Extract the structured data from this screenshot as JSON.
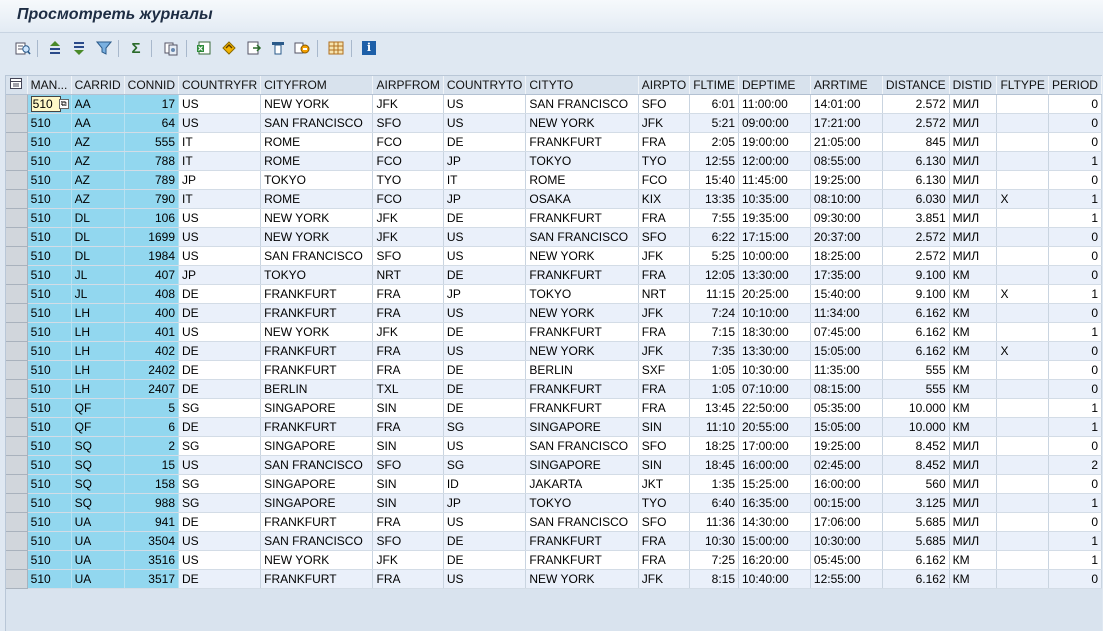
{
  "window": {
    "title": "Просмотреть журналы"
  },
  "toolbar": {
    "buttons": [
      {
        "icon": "details-icon",
        "label": ""
      },
      {
        "icon": "sort-ascending-icon",
        "label": ""
      },
      {
        "icon": "sort-descending-icon",
        "label": ""
      },
      {
        "icon": "filter-icon",
        "label": ""
      },
      {
        "icon": "sum-icon",
        "label": ""
      },
      {
        "icon": "subtotals-icon",
        "label": ""
      },
      {
        "icon": "export-excel-icon",
        "label": ""
      },
      {
        "icon": "print-preview-icon",
        "label": ""
      },
      {
        "icon": "export-icon",
        "label": ""
      },
      {
        "icon": "change-layout-icon",
        "label": ""
      },
      {
        "icon": "select-layout-icon",
        "label": ""
      },
      {
        "icon": "grid-layout-icon",
        "label": ""
      },
      {
        "icon": "info-icon",
        "label": "i"
      }
    ]
  },
  "grid": {
    "columns": [
      "MAN...",
      "CARRID",
      "CONNID",
      "COUNTRYFR",
      "CITYFROM",
      "AIRPFROM",
      "COUNTRYTO",
      "CITYTO",
      "AIRPTO",
      "FLTIME",
      "DEPTIME",
      "ARRTIME",
      "DISTANCE",
      "DISTID",
      "FLTYPE",
      "PERIOD"
    ],
    "rows": [
      [
        "510",
        "AA",
        "17",
        "US",
        "NEW YORK",
        "JFK",
        "US",
        "SAN FRANCISCO",
        "SFO",
        "6:01",
        "11:00:00",
        "14:01:00",
        "2.572",
        "МИЛ",
        "",
        "0"
      ],
      [
        "510",
        "AA",
        "64",
        "US",
        "SAN FRANCISCO",
        "SFO",
        "US",
        "NEW YORK",
        "JFK",
        "5:21",
        "09:00:00",
        "17:21:00",
        "2.572",
        "МИЛ",
        "",
        "0"
      ],
      [
        "510",
        "AZ",
        "555",
        "IT",
        "ROME",
        "FCO",
        "DE",
        "FRANKFURT",
        "FRA",
        "2:05",
        "19:00:00",
        "21:05:00",
        "845",
        "МИЛ",
        "",
        "0"
      ],
      [
        "510",
        "AZ",
        "788",
        "IT",
        "ROME",
        "FCO",
        "JP",
        "TOKYO",
        "TYO",
        "12:55",
        "12:00:00",
        "08:55:00",
        "6.130",
        "МИЛ",
        "",
        "1"
      ],
      [
        "510",
        "AZ",
        "789",
        "JP",
        "TOKYO",
        "TYO",
        "IT",
        "ROME",
        "FCO",
        "15:40",
        "11:45:00",
        "19:25:00",
        "6.130",
        "МИЛ",
        "",
        "0"
      ],
      [
        "510",
        "AZ",
        "790",
        "IT",
        "ROME",
        "FCO",
        "JP",
        "OSAKA",
        "KIX",
        "13:35",
        "10:35:00",
        "08:10:00",
        "6.030",
        "МИЛ",
        "X",
        "1"
      ],
      [
        "510",
        "DL",
        "106",
        "US",
        "NEW YORK",
        "JFK",
        "DE",
        "FRANKFURT",
        "FRA",
        "7:55",
        "19:35:00",
        "09:30:00",
        "3.851",
        "МИЛ",
        "",
        "1"
      ],
      [
        "510",
        "DL",
        "1699",
        "US",
        "NEW YORK",
        "JFK",
        "US",
        "SAN FRANCISCO",
        "SFO",
        "6:22",
        "17:15:00",
        "20:37:00",
        "2.572",
        "МИЛ",
        "",
        "0"
      ],
      [
        "510",
        "DL",
        "1984",
        "US",
        "SAN FRANCISCO",
        "SFO",
        "US",
        "NEW YORK",
        "JFK",
        "5:25",
        "10:00:00",
        "18:25:00",
        "2.572",
        "МИЛ",
        "",
        "0"
      ],
      [
        "510",
        "JL",
        "407",
        "JP",
        "TOKYO",
        "NRT",
        "DE",
        "FRANKFURT",
        "FRA",
        "12:05",
        "13:30:00",
        "17:35:00",
        "9.100",
        "КМ",
        "",
        "0"
      ],
      [
        "510",
        "JL",
        "408",
        "DE",
        "FRANKFURT",
        "FRA",
        "JP",
        "TOKYO",
        "NRT",
        "11:15",
        "20:25:00",
        "15:40:00",
        "9.100",
        "КМ",
        "X",
        "1"
      ],
      [
        "510",
        "LH",
        "400",
        "DE",
        "FRANKFURT",
        "FRA",
        "US",
        "NEW YORK",
        "JFK",
        "7:24",
        "10:10:00",
        "11:34:00",
        "6.162",
        "КМ",
        "",
        "0"
      ],
      [
        "510",
        "LH",
        "401",
        "US",
        "NEW YORK",
        "JFK",
        "DE",
        "FRANKFURT",
        "FRA",
        "7:15",
        "18:30:00",
        "07:45:00",
        "6.162",
        "КМ",
        "",
        "1"
      ],
      [
        "510",
        "LH",
        "402",
        "DE",
        "FRANKFURT",
        "FRA",
        "US",
        "NEW YORK",
        "JFK",
        "7:35",
        "13:30:00",
        "15:05:00",
        "6.162",
        "КМ",
        "X",
        "0"
      ],
      [
        "510",
        "LH",
        "2402",
        "DE",
        "FRANKFURT",
        "FRA",
        "DE",
        "BERLIN",
        "SXF",
        "1:05",
        "10:30:00",
        "11:35:00",
        "555",
        "КМ",
        "",
        "0"
      ],
      [
        "510",
        "LH",
        "2407",
        "DE",
        "BERLIN",
        "TXL",
        "DE",
        "FRANKFURT",
        "FRA",
        "1:05",
        "07:10:00",
        "08:15:00",
        "555",
        "КМ",
        "",
        "0"
      ],
      [
        "510",
        "QF",
        "5",
        "SG",
        "SINGAPORE",
        "SIN",
        "DE",
        "FRANKFURT",
        "FRA",
        "13:45",
        "22:50:00",
        "05:35:00",
        "10.000",
        "КМ",
        "",
        "1"
      ],
      [
        "510",
        "QF",
        "6",
        "DE",
        "FRANKFURT",
        "FRA",
        "SG",
        "SINGAPORE",
        "SIN",
        "11:10",
        "20:55:00",
        "15:05:00",
        "10.000",
        "КМ",
        "",
        "1"
      ],
      [
        "510",
        "SQ",
        "2",
        "SG",
        "SINGAPORE",
        "SIN",
        "US",
        "SAN FRANCISCO",
        "SFO",
        "18:25",
        "17:00:00",
        "19:25:00",
        "8.452",
        "МИЛ",
        "",
        "0"
      ],
      [
        "510",
        "SQ",
        "15",
        "US",
        "SAN FRANCISCO",
        "SFO",
        "SG",
        "SINGAPORE",
        "SIN",
        "18:45",
        "16:00:00",
        "02:45:00",
        "8.452",
        "МИЛ",
        "",
        "2"
      ],
      [
        "510",
        "SQ",
        "158",
        "SG",
        "SINGAPORE",
        "SIN",
        "ID",
        "JAKARTA",
        "JKT",
        "1:35",
        "15:25:00",
        "16:00:00",
        "560",
        "МИЛ",
        "",
        "0"
      ],
      [
        "510",
        "SQ",
        "988",
        "SG",
        "SINGAPORE",
        "SIN",
        "JP",
        "TOKYO",
        "TYO",
        "6:40",
        "16:35:00",
        "00:15:00",
        "3.125",
        "МИЛ",
        "",
        "1"
      ],
      [
        "510",
        "UA",
        "941",
        "DE",
        "FRANKFURT",
        "FRA",
        "US",
        "SAN FRANCISCO",
        "SFO",
        "11:36",
        "14:30:00",
        "17:06:00",
        "5.685",
        "МИЛ",
        "",
        "0"
      ],
      [
        "510",
        "UA",
        "3504",
        "US",
        "SAN FRANCISCO",
        "SFO",
        "DE",
        "FRANKFURT",
        "FRA",
        "10:30",
        "15:00:00",
        "10:30:00",
        "5.685",
        "МИЛ",
        "",
        "1"
      ],
      [
        "510",
        "UA",
        "3516",
        "US",
        "NEW YORK",
        "JFK",
        "DE",
        "FRANKFURT",
        "FRA",
        "7:25",
        "16:20:00",
        "05:45:00",
        "6.162",
        "КМ",
        "",
        "1"
      ],
      [
        "510",
        "UA",
        "3517",
        "DE",
        "FRANKFURT",
        "FRA",
        "US",
        "NEW YORK",
        "JFK",
        "8:15",
        "10:40:00",
        "12:55:00",
        "6.162",
        "КМ",
        "",
        "0"
      ]
    ],
    "active_cell_value": "510"
  }
}
